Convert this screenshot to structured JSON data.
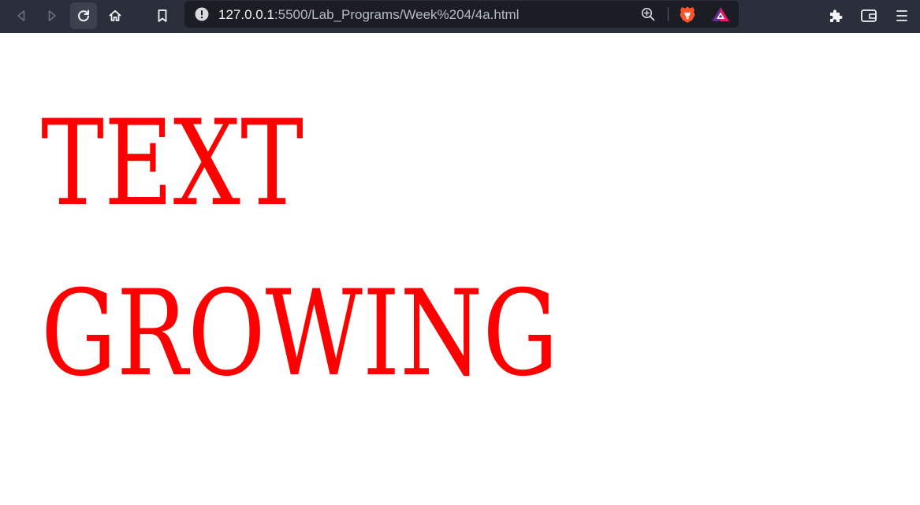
{
  "browser": {
    "url_host": "127.0.0.1",
    "url_path": ":5500/Lab_Programs/Week%204/4a.html",
    "icons": {
      "back": "back-arrow-icon",
      "forward": "forward-arrow-icon",
      "reload": "reload-icon",
      "home": "home-icon",
      "bookmark": "bookmark-icon",
      "site_info": "site-info-icon",
      "zoom": "zoom-icon",
      "shields": "brave-shields-icon",
      "rewards": "brave-rewards-icon",
      "extensions": "extensions-icon",
      "wallet": "wallet-icon",
      "menu": "menu-icon"
    },
    "colors": {
      "toolbar": "#2b2f3b",
      "urlbar": "#1b1d24",
      "shields_orange": "#fb542b"
    }
  },
  "page": {
    "line1": "TEXT",
    "line2": "GROWING",
    "text_color": "#ff0000",
    "background": "#ffffff"
  }
}
